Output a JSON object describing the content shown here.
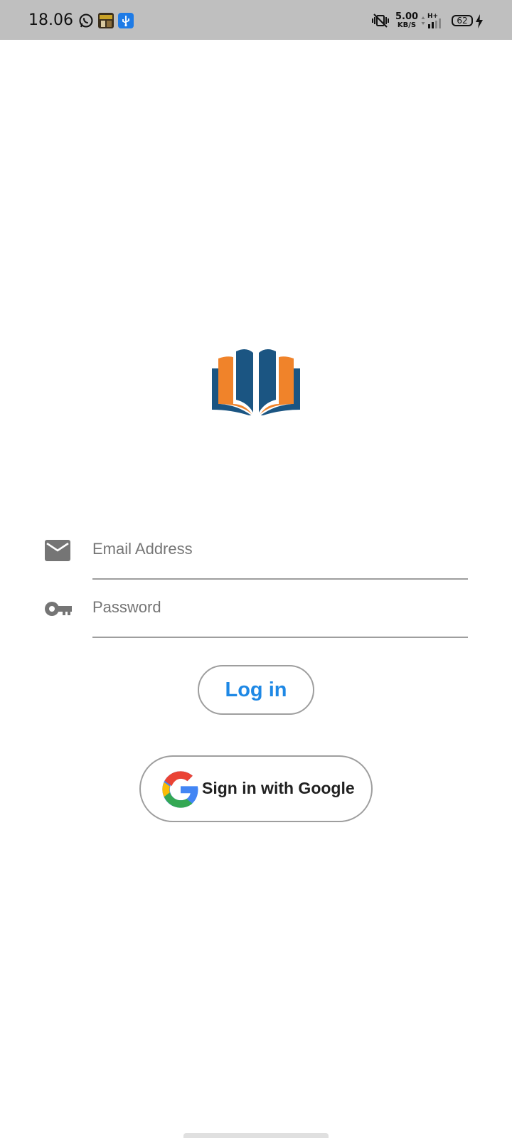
{
  "status_bar": {
    "time": "18.06",
    "net_speed_value": "5.00",
    "net_speed_unit": "KB/S",
    "network_type": "H+",
    "battery_level": "62",
    "icons": [
      "whatsapp-icon",
      "game-app-icon",
      "usb-icon",
      "vibrate-mute-icon",
      "signal-icon",
      "battery-icon",
      "charging-icon"
    ]
  },
  "login_form": {
    "email_placeholder": "Email Address",
    "password_placeholder": "Password",
    "login_label": "Log in",
    "google_label": "Sign in with Google"
  },
  "colors": {
    "status_bar_bg": "#bfbfbf",
    "logo_blue": "#1b5582",
    "logo_orange": "#f0832a",
    "login_text": "#1e88e5",
    "button_border": "#9e9e9e",
    "field_icon": "#757575"
  }
}
